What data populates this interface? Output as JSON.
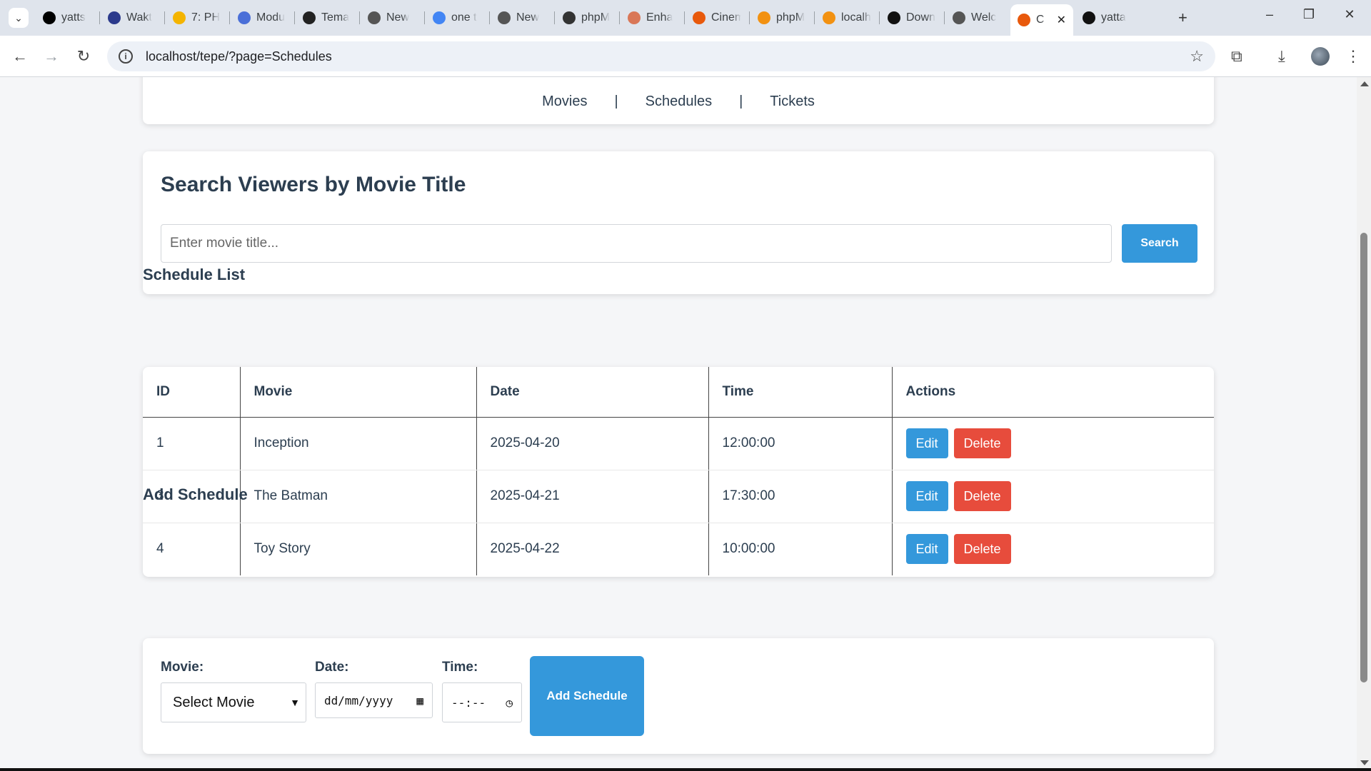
{
  "browser": {
    "tabs": [
      {
        "label": "yatts",
        "icon": "x-logo-icon",
        "color": "#000000"
      },
      {
        "label": "Wakt",
        "icon": "wakatime-icon",
        "color": "#2b3a8c"
      },
      {
        "label": "7: PH",
        "icon": "google-drive-icon",
        "color": "#f4b400"
      },
      {
        "label": "Modu",
        "icon": "docs-icon",
        "color": "#4a6fd8"
      },
      {
        "label": "Tema",
        "icon": "chatgpt-icon",
        "color": "#222222"
      },
      {
        "label": "New",
        "icon": "chrome-icon",
        "color": "#555555"
      },
      {
        "label": "one t",
        "icon": "google-icon",
        "color": "#4285f4"
      },
      {
        "label": "New",
        "icon": "chrome-icon",
        "color": "#555555"
      },
      {
        "label": "phpM",
        "icon": "laptop-icon",
        "color": "#333333"
      },
      {
        "label": "Enha",
        "icon": "claude-icon",
        "color": "#d97757"
      },
      {
        "label": "Cinem",
        "icon": "xampp-icon",
        "color": "#e8590c"
      },
      {
        "label": "phpM",
        "icon": "phpmyadmin-icon",
        "color": "#f29111"
      },
      {
        "label": "localh",
        "icon": "phpmyadmin-icon",
        "color": "#f29111"
      },
      {
        "label": "Down",
        "icon": "github-dark-icon",
        "color": "#111111"
      },
      {
        "label": "Welc",
        "icon": "globe-icon",
        "color": "#555555"
      },
      {
        "label": "C",
        "icon": "xampp-icon",
        "color": "#e8590c",
        "active": true
      },
      {
        "label": "yatta",
        "icon": "github-icon",
        "color": "#111111"
      }
    ],
    "url": "localhost/tepe/?page=Schedules"
  },
  "nav": {
    "movies": "Movies",
    "schedules": "Schedules",
    "tickets": "Tickets",
    "separator": "|"
  },
  "search": {
    "title": "Search Viewers by Movie Title",
    "placeholder": "Enter movie title...",
    "button": "Search"
  },
  "schedule_list": {
    "title": "Schedule List",
    "columns": [
      "ID",
      "Movie",
      "Date",
      "Time",
      "Actions"
    ],
    "rows": [
      {
        "id": "1",
        "movie": "Inception",
        "date": "2025-04-20",
        "time": "12:00:00"
      },
      {
        "id": "3",
        "movie": "The Batman",
        "date": "2025-04-21",
        "time": "17:30:00"
      },
      {
        "id": "4",
        "movie": "Toy Story",
        "date": "2025-04-22",
        "time": "10:00:00"
      }
    ],
    "edit_label": "Edit",
    "delete_label": "Delete"
  },
  "add_schedule": {
    "title": "Add Schedule",
    "movie_label": "Movie:",
    "movie_selected": "Select Movie",
    "date_label": "Date:",
    "date_placeholder": "dd/mm/yyyy",
    "time_label": "Time:",
    "time_placeholder": "--:--",
    "button": "Add Schedule"
  },
  "colors": {
    "primary": "#3498db",
    "danger": "#e74c3c",
    "text": "#2c3e50"
  }
}
